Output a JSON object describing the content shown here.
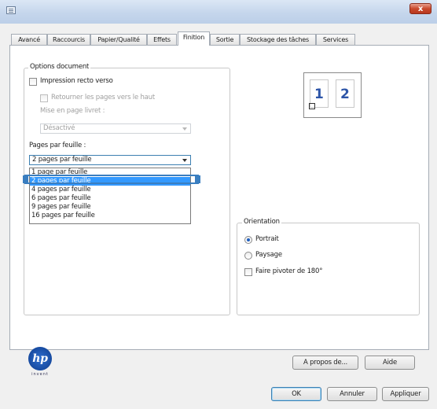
{
  "window": {
    "close_label": "x"
  },
  "tabs": [
    {
      "label": "Avancé"
    },
    {
      "label": "Raccourcis"
    },
    {
      "label": "Papier/Qualité"
    },
    {
      "label": "Effets"
    },
    {
      "label": "Finition",
      "active": true
    },
    {
      "label": "Sortie"
    },
    {
      "label": "Stockage des tâches"
    },
    {
      "label": "Services"
    }
  ],
  "document_options": {
    "legend": "Options document",
    "duplex_label": "Impression recto verso",
    "flip_up_label": "Retourner les pages vers le haut",
    "booklet_label": "Mise en page livret :",
    "booklet_value": "Désactivé",
    "pages_per_sheet_label": "Pages par feuille :",
    "pages_per_sheet_value": "2 pages par feuille",
    "pages_per_sheet_options": [
      "1 page par feuille",
      "2 pages par feuille",
      "4 pages par feuille",
      "6 pages par feuille",
      "9 pages par feuille",
      "16 pages par feuille"
    ],
    "selected_index": 1
  },
  "preview": {
    "page1": "1",
    "page2": "2"
  },
  "orientation": {
    "legend": "Orientation",
    "portrait_label": "Portrait",
    "landscape_label": "Paysage",
    "rotate_label": "Faire pivoter de 180°",
    "selected": "portrait"
  },
  "logo": {
    "text": "hp",
    "subtext": "invent"
  },
  "buttons": {
    "about": "A propos de...",
    "help": "Aide",
    "ok": "OK",
    "cancel": "Annuler",
    "apply": "Appliquer"
  }
}
